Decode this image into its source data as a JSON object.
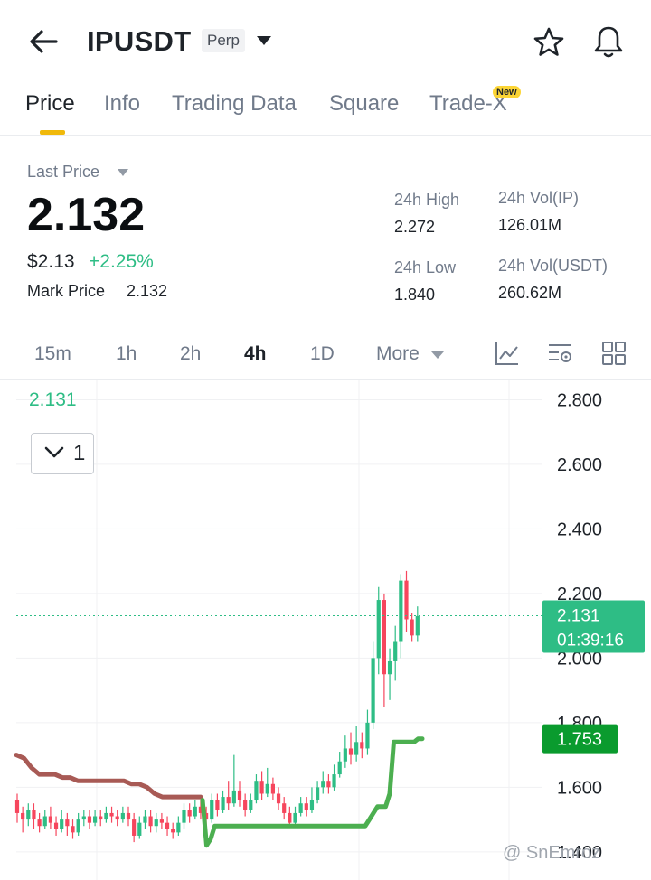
{
  "header": {
    "symbol": "IPUSDT",
    "contract_type": "Perp"
  },
  "tabs": [
    {
      "label": "Price",
      "active": true
    },
    {
      "label": "Info"
    },
    {
      "label": "Trading Data"
    },
    {
      "label": "Square"
    },
    {
      "label": "Trade-X",
      "badge": "New"
    }
  ],
  "stats": {
    "last_price_label": "Last Price",
    "last_price": "2.132",
    "usd_price": "$2.13",
    "change_pct": "+2.25%",
    "mark_price_label": "Mark Price",
    "mark_price": "2.132",
    "high_label": "24h High",
    "high": "2.272",
    "low_label": "24h Low",
    "low": "1.840",
    "vol_ip_label": "24h Vol(IP)",
    "vol_ip": "126.01M",
    "vol_usdt_label": "24h Vol(USDT)",
    "vol_usdt": "260.62M"
  },
  "intervals": [
    "15m",
    "1h",
    "2h",
    "4h",
    "1D",
    "More"
  ],
  "active_interval": "4h",
  "chart_panel": {
    "indicator_value": "2.131",
    "collapsed_count": "1",
    "watermark": "@ SnEmroz"
  },
  "colors": {
    "up": "#2ebd85",
    "down": "#f6465d",
    "accent": "#f0b90b"
  },
  "chart_data": {
    "type": "candlestick",
    "y_ticks": [
      2.8,
      2.6,
      2.4,
      2.2,
      2.0,
      1.8,
      1.6,
      1.4
    ],
    "y_tick_labels": [
      "2.800",
      "2.600",
      "2.400",
      "2.200",
      "2.000",
      "1.800",
      "1.600",
      "1.400"
    ],
    "ylim": [
      1.31,
      2.86
    ],
    "current_price": {
      "value": 2.131,
      "label": "2.131",
      "countdown": "01:39:16"
    },
    "indicator_price": {
      "value": 1.753,
      "label": "1.753"
    },
    "candles": [
      [
        1.56,
        1.52,
        1.58,
        1.49
      ],
      [
        1.52,
        1.5,
        1.54,
        1.46
      ],
      [
        1.5,
        1.53,
        1.55,
        1.48
      ],
      [
        1.53,
        1.5,
        1.55,
        1.47
      ],
      [
        1.5,
        1.48,
        1.52,
        1.46
      ],
      [
        1.48,
        1.51,
        1.53,
        1.47
      ],
      [
        1.51,
        1.49,
        1.54,
        1.47
      ],
      [
        1.49,
        1.47,
        1.51,
        1.45
      ],
      [
        1.47,
        1.5,
        1.53,
        1.46
      ],
      [
        1.5,
        1.48,
        1.52,
        1.45
      ],
      [
        1.48,
        1.46,
        1.5,
        1.44
      ],
      [
        1.46,
        1.5,
        1.52,
        1.45
      ],
      [
        1.5,
        1.51,
        1.53,
        1.48
      ],
      [
        1.51,
        1.49,
        1.53,
        1.47
      ],
      [
        1.49,
        1.51,
        1.53,
        1.48
      ],
      [
        1.51,
        1.5,
        1.53,
        1.48
      ],
      [
        1.5,
        1.52,
        1.54,
        1.49
      ],
      [
        1.52,
        1.51,
        1.54,
        1.49
      ],
      [
        1.51,
        1.5,
        1.53,
        1.48
      ],
      [
        1.5,
        1.52,
        1.54,
        1.49
      ],
      [
        1.52,
        1.5,
        1.54,
        1.48
      ],
      [
        1.5,
        1.45,
        1.52,
        1.43
      ],
      [
        1.45,
        1.49,
        1.51,
        1.44
      ],
      [
        1.49,
        1.51,
        1.53,
        1.47
      ],
      [
        1.51,
        1.48,
        1.53,
        1.46
      ],
      [
        1.48,
        1.5,
        1.52,
        1.46
      ],
      [
        1.5,
        1.49,
        1.52,
        1.47
      ],
      [
        1.49,
        1.47,
        1.51,
        1.45
      ],
      [
        1.47,
        1.46,
        1.49,
        1.44
      ],
      [
        1.46,
        1.49,
        1.51,
        1.45
      ],
      [
        1.49,
        1.53,
        1.55,
        1.47
      ],
      [
        1.53,
        1.51,
        1.55,
        1.49
      ],
      [
        1.51,
        1.54,
        1.56,
        1.5
      ],
      [
        1.54,
        1.52,
        1.56,
        1.5
      ],
      [
        1.52,
        1.5,
        1.54,
        1.48
      ],
      [
        1.5,
        1.56,
        1.58,
        1.49
      ],
      [
        1.56,
        1.53,
        1.58,
        1.51
      ],
      [
        1.53,
        1.57,
        1.59,
        1.52
      ],
      [
        1.57,
        1.55,
        1.62,
        1.53
      ],
      [
        1.55,
        1.59,
        1.7,
        1.54
      ],
      [
        1.59,
        1.56,
        1.62,
        1.54
      ],
      [
        1.56,
        1.53,
        1.58,
        1.51
      ],
      [
        1.53,
        1.56,
        1.58,
        1.52
      ],
      [
        1.56,
        1.62,
        1.64,
        1.55
      ],
      [
        1.62,
        1.58,
        1.65,
        1.56
      ],
      [
        1.58,
        1.61,
        1.66,
        1.57
      ],
      [
        1.61,
        1.58,
        1.63,
        1.56
      ],
      [
        1.58,
        1.55,
        1.6,
        1.53
      ],
      [
        1.55,
        1.52,
        1.57,
        1.5
      ],
      [
        1.52,
        1.49,
        1.54,
        1.48
      ],
      [
        1.49,
        1.52,
        1.54,
        1.48
      ],
      [
        1.52,
        1.55,
        1.57,
        1.51
      ],
      [
        1.55,
        1.53,
        1.57,
        1.51
      ],
      [
        1.53,
        1.56,
        1.6,
        1.52
      ],
      [
        1.56,
        1.6,
        1.62,
        1.55
      ],
      [
        1.6,
        1.62,
        1.65,
        1.58
      ],
      [
        1.62,
        1.6,
        1.64,
        1.58
      ],
      [
        1.6,
        1.64,
        1.67,
        1.59
      ],
      [
        1.64,
        1.68,
        1.71,
        1.63
      ],
      [
        1.68,
        1.72,
        1.76,
        1.66
      ],
      [
        1.72,
        1.7,
        1.77,
        1.67
      ],
      [
        1.7,
        1.74,
        1.79,
        1.68
      ],
      [
        1.74,
        1.72,
        1.77,
        1.69
      ],
      [
        1.72,
        1.8,
        1.84,
        1.7
      ],
      [
        1.8,
        2.0,
        2.05,
        1.78
      ],
      [
        2.0,
        2.18,
        2.22,
        1.95
      ],
      [
        2.18,
        1.95,
        2.2,
        1.85
      ],
      [
        1.95,
        1.99,
        2.03,
        1.87
      ],
      [
        1.99,
        2.05,
        2.1,
        1.93
      ],
      [
        2.05,
        2.24,
        2.26,
        2.0
      ],
      [
        2.24,
        2.12,
        2.27,
        2.08
      ],
      [
        2.12,
        2.07,
        2.14,
        2.05
      ],
      [
        2.07,
        2.13,
        2.16,
        2.05
      ]
    ],
    "supertrend_down": [
      1.7,
      1.69,
      1.66,
      1.64,
      1.64,
      1.64,
      1.63,
      1.63,
      1.62,
      1.62,
      1.62,
      1.62,
      1.62,
      1.62,
      1.62,
      1.61,
      1.61,
      1.6,
      1.58,
      1.57,
      1.57,
      1.57,
      1.57,
      1.57,
      1.57
    ],
    "supertrend_up": [
      1.56,
      1.42,
      1.44,
      1.48,
      1.48,
      1.48,
      1.48,
      1.48,
      1.48,
      1.48,
      1.48,
      1.48,
      1.48,
      1.48,
      1.48,
      1.48,
      1.48,
      1.48,
      1.48,
      1.48,
      1.48,
      1.48,
      1.48,
      1.48,
      1.48,
      1.48,
      1.48,
      1.48,
      1.48,
      1.48,
      1.48,
      1.48,
      1.48,
      1.48,
      1.48,
      1.48,
      1.48,
      1.48,
      1.48,
      1.48,
      1.48,
      1.5,
      1.52,
      1.54,
      1.54,
      1.54,
      1.58,
      1.74,
      1.74,
      1.74,
      1.74,
      1.74,
      1.74,
      1.75,
      1.75
    ]
  }
}
